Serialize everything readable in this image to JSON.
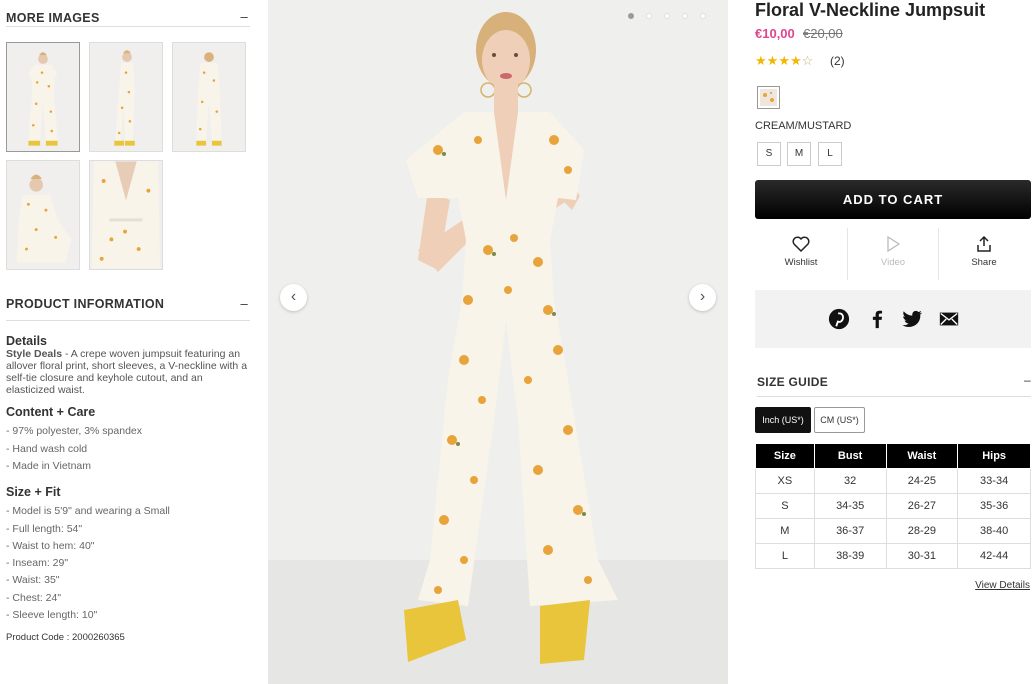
{
  "more_images": {
    "title": "MORE IMAGES",
    "toggle": "–",
    "count": 5
  },
  "product_info": {
    "title": "PRODUCT INFORMATION",
    "toggle": "–",
    "details_heading": "Details",
    "details_lead": "Style Deals",
    "details_text": " - A crepe woven jumpsuit featuring an allover floral print, short sleeves, a V-neckline with a self-tie closure and keyhole cutout, and an elasticized waist.",
    "content_heading": "Content + Care",
    "content_items": [
      "- 97% polyester, 3% spandex",
      "- Hand wash cold",
      "- Made in Vietnam"
    ],
    "size_heading": "Size + Fit",
    "size_items": [
      "- Model is 5'9\" and wearing a Small",
      "- Full length: 54\"",
      "- Waist to hem: 40\"",
      "- Inseam: 29\"",
      "- Waist: 35\"",
      "- Chest: 24\"",
      "- Sleeve length: 10\""
    ],
    "product_code": "Product Code : 2000260365"
  },
  "gallery": {
    "prev": "‹",
    "next": "›",
    "dot_count": 5,
    "active_dot": 0
  },
  "product": {
    "title": "Floral V-Neckline Jumpsuit",
    "price": "€10,00",
    "old_price": "€20,00",
    "rating": 4,
    "rating_max": 5,
    "review_count": "(2)",
    "color_name": "CREAM/MUSTARD",
    "sizes": [
      "S",
      "M",
      "L"
    ],
    "add_to_cart": "ADD TO CART"
  },
  "actions": {
    "wishlist": "Wishlist",
    "video": "Video",
    "share": "Share"
  },
  "social": [
    "pinterest-icon",
    "facebook-icon",
    "twitter-icon",
    "email-icon"
  ],
  "size_guide": {
    "title": "SIZE GUIDE",
    "toggle": "–",
    "unit_inch": "Inch (US*)",
    "unit_cm": "CM (US*)",
    "headers": [
      "Size",
      "Bust",
      "Waist",
      "Hips"
    ],
    "rows": [
      [
        "XS",
        "32",
        "24-25",
        "33-34"
      ],
      [
        "S",
        "34-35",
        "26-27",
        "35-36"
      ],
      [
        "M",
        "36-37",
        "28-29",
        "38-40"
      ],
      [
        "L",
        "38-39",
        "30-31",
        "42-44"
      ]
    ],
    "view_details": "View Details"
  },
  "colors": {
    "accent_price": "#e0468f",
    "star": "#f2b700",
    "button": "#000000",
    "dress": "#f7f3ea",
    "flower": "#e8a33a",
    "shoe": "#e9c53c"
  }
}
